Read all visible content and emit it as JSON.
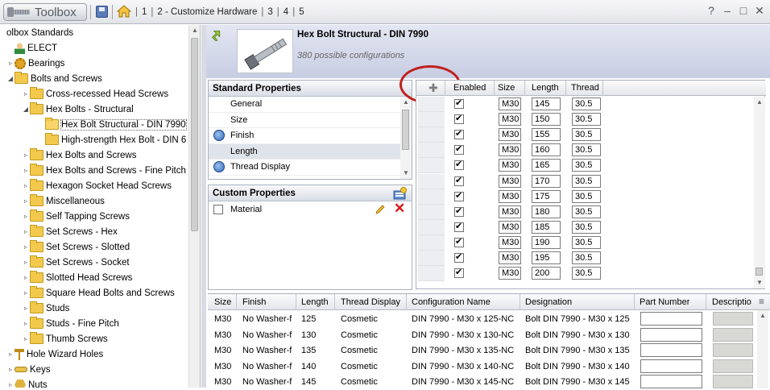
{
  "titlebar": {
    "app_name": "Toolbox",
    "breadcrumb": [
      "1",
      "2 - Customize Hardware",
      "3",
      "4",
      "5"
    ],
    "help": "?",
    "minimize": "–",
    "maximize": "□",
    "close": "✕"
  },
  "tree": {
    "items": [
      {
        "label": "olbox Standards",
        "indent": 0,
        "icon": "none",
        "exp": ""
      },
      {
        "label": "ELECT",
        "indent": 1,
        "icon": "user-icon",
        "exp": ""
      },
      {
        "label": "Bearings",
        "indent": 1,
        "icon": "gear-icon",
        "exp": "▹"
      },
      {
        "label": "Bolts and Screws",
        "indent": 1,
        "icon": "folder-icon",
        "exp": "◢"
      },
      {
        "label": "Cross-recessed Head Screws",
        "indent": 2,
        "icon": "folder-icon",
        "exp": "▹"
      },
      {
        "label": "Hex Bolts - Structural",
        "indent": 2,
        "icon": "folder-icon",
        "exp": "◢"
      },
      {
        "label": "Hex Bolt Structural - DIN 7990",
        "indent": 3,
        "icon": "folder-icon",
        "exp": "",
        "selected": true
      },
      {
        "label": "High-strength Hex Bolt - DIN 6",
        "indent": 3,
        "icon": "folder-icon",
        "exp": ""
      },
      {
        "label": "Hex Bolts and Screws",
        "indent": 2,
        "icon": "folder-icon",
        "exp": "▹"
      },
      {
        "label": "Hex Bolts and Screws - Fine Pitch",
        "indent": 2,
        "icon": "folder-icon",
        "exp": "▹"
      },
      {
        "label": "Hexagon Socket Head Screws",
        "indent": 2,
        "icon": "folder-icon",
        "exp": "▹"
      },
      {
        "label": "Miscellaneous",
        "indent": 2,
        "icon": "folder-icon",
        "exp": "▹"
      },
      {
        "label": "Self Tapping Screws",
        "indent": 2,
        "icon": "folder-icon",
        "exp": "▹"
      },
      {
        "label": "Set Screws - Hex",
        "indent": 2,
        "icon": "folder-icon",
        "exp": "▹"
      },
      {
        "label": "Set Screws - Slotted",
        "indent": 2,
        "icon": "folder-icon",
        "exp": "▹"
      },
      {
        "label": "Set Screws - Socket",
        "indent": 2,
        "icon": "folder-icon",
        "exp": "▹"
      },
      {
        "label": "Slotted Head Screws",
        "indent": 2,
        "icon": "folder-icon",
        "exp": "▹"
      },
      {
        "label": "Square Head Bolts and Screws",
        "indent": 2,
        "icon": "folder-icon",
        "exp": "▹"
      },
      {
        "label": "Studs",
        "indent": 2,
        "icon": "folder-icon",
        "exp": "▹"
      },
      {
        "label": "Studs - Fine Pitch",
        "indent": 2,
        "icon": "folder-icon",
        "exp": "▹"
      },
      {
        "label": "Thumb Screws",
        "indent": 2,
        "icon": "folder-icon",
        "exp": "▹"
      },
      {
        "label": "Hole Wizard Holes",
        "indent": 1,
        "icon": "hole-icon",
        "exp": "▹"
      },
      {
        "label": "Keys",
        "indent": 1,
        "icon": "key-icon",
        "exp": "▹"
      },
      {
        "label": "Nuts",
        "indent": 1,
        "icon": "nut-icon",
        "exp": "▹"
      }
    ]
  },
  "part": {
    "title": "Hex Bolt Structural - DIN 7990",
    "configs": "380 possible configurations"
  },
  "standard_properties": {
    "title": "Standard Properties",
    "items": [
      {
        "label": "General",
        "globe": false,
        "selected": false
      },
      {
        "label": "Size",
        "globe": false,
        "selected": false
      },
      {
        "label": "Finish",
        "globe": true,
        "selected": false
      },
      {
        "label": "Length",
        "globe": false,
        "selected": true
      },
      {
        "label": "Thread Display",
        "globe": true,
        "selected": false
      }
    ]
  },
  "custom_properties": {
    "title": "Custom Properties",
    "items": [
      {
        "label": "Material",
        "checked": false
      }
    ]
  },
  "config_grid": {
    "headers": [
      "Enabled",
      "Size",
      "Length",
      "Thread"
    ],
    "rows": [
      {
        "enabled": true,
        "size": "M30",
        "length": "145",
        "thread": "30.5"
      },
      {
        "enabled": true,
        "size": "M30",
        "length": "150",
        "thread": "30.5"
      },
      {
        "enabled": true,
        "size": "M30",
        "length": "155",
        "thread": "30.5"
      },
      {
        "enabled": true,
        "size": "M30",
        "length": "160",
        "thread": "30.5"
      },
      {
        "enabled": true,
        "size": "M30",
        "length": "165",
        "thread": "30.5"
      },
      {
        "enabled": true,
        "size": "M30",
        "length": "170",
        "thread": "30.5"
      },
      {
        "enabled": true,
        "size": "M30",
        "length": "175",
        "thread": "30.5"
      },
      {
        "enabled": true,
        "size": "M30",
        "length": "180",
        "thread": "30.5"
      },
      {
        "enabled": true,
        "size": "M30",
        "length": "185",
        "thread": "30.5"
      },
      {
        "enabled": true,
        "size": "M30",
        "length": "190",
        "thread": "30.5"
      },
      {
        "enabled": true,
        "size": "M30",
        "length": "195",
        "thread": "30.5"
      },
      {
        "enabled": true,
        "size": "M30",
        "length": "200",
        "thread": "30.5"
      }
    ]
  },
  "config_table": {
    "headers": [
      "Size",
      "Finish",
      "Length",
      "Thread Display",
      "Configuration Name",
      "Designation",
      "Part Number",
      "Descriptio"
    ],
    "rows": [
      {
        "size": "M30",
        "finish": "No Washer-f",
        "length": "125",
        "thread": "Cosmetic",
        "config": "DIN 7990 - M30 x 125-NC",
        "designation": "Bolt DIN 7990 - M30 x 125"
      },
      {
        "size": "M30",
        "finish": "No Washer-f",
        "length": "130",
        "thread": "Cosmetic",
        "config": "DIN 7990 - M30 x 130-NC",
        "designation": "Bolt DIN 7990 - M30 x 130"
      },
      {
        "size": "M30",
        "finish": "No Washer-f",
        "length": "135",
        "thread": "Cosmetic",
        "config": "DIN 7990 - M30 x 135-NC",
        "designation": "Bolt DIN 7990 - M30 x 135"
      },
      {
        "size": "M30",
        "finish": "No Washer-f",
        "length": "140",
        "thread": "Cosmetic",
        "config": "DIN 7990 - M30 x 140-NC",
        "designation": "Bolt DIN 7990 - M30 x 140"
      },
      {
        "size": "M30",
        "finish": "No Washer-f",
        "length": "145",
        "thread": "Cosmetic",
        "config": "DIN 7990 - M30 x 145-NC",
        "designation": "Bolt DIN 7990 - M30 x 145"
      }
    ]
  },
  "colors": {
    "callout": "#c0201c",
    "header_bg": "#c7cde2"
  }
}
